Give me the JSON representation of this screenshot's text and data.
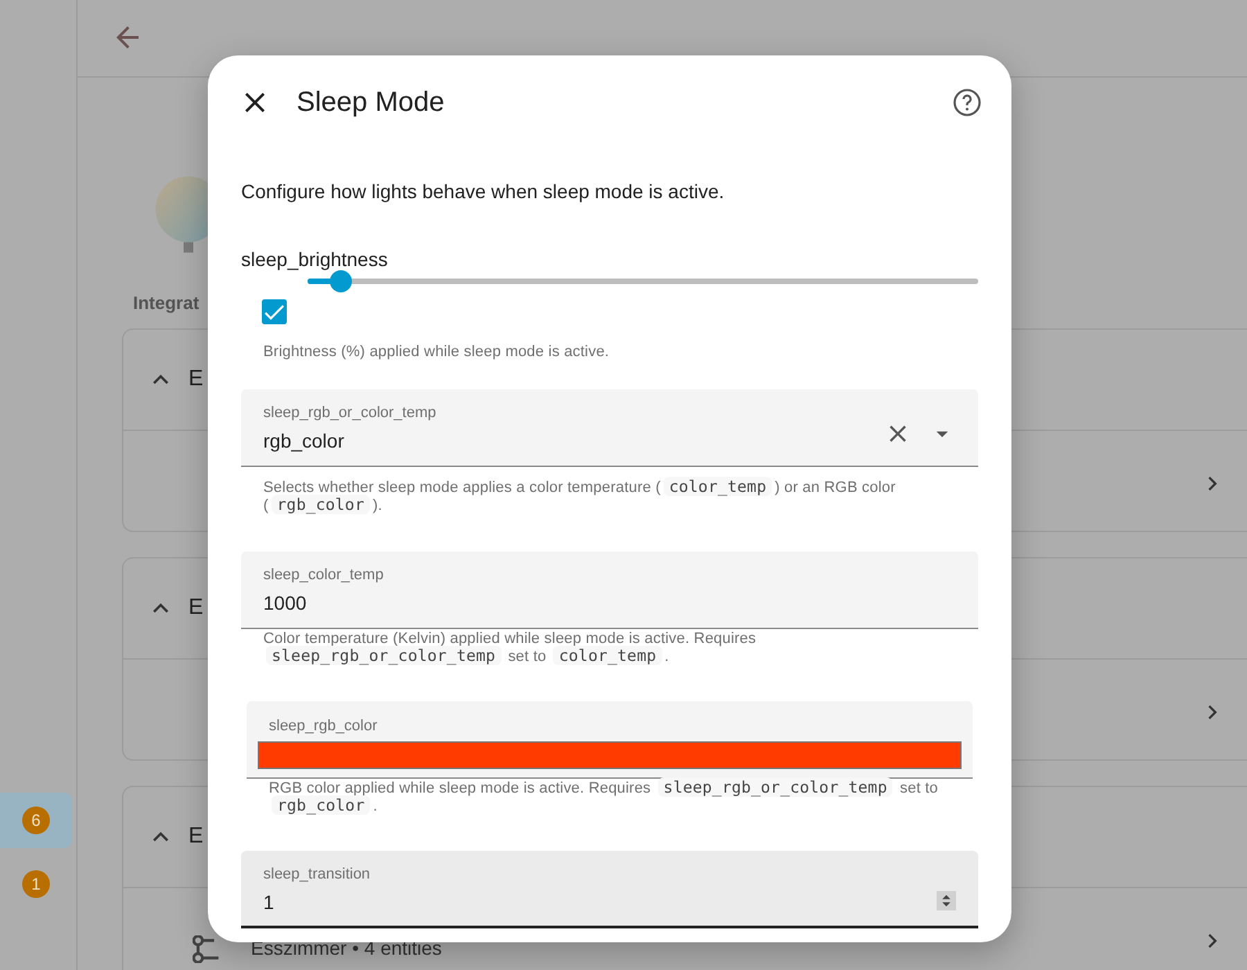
{
  "background": {
    "nav_badges": [
      {
        "text": "6",
        "selected": true
      },
      {
        "text": "1",
        "selected": false
      }
    ],
    "section_heading": "Integrat",
    "cards": [
      {
        "title": "E",
        "expanded": true
      },
      {
        "title": "E",
        "expanded": true
      },
      {
        "title": "E",
        "expanded": true,
        "subtitle": "Esszimmer • 4 entities"
      }
    ]
  },
  "dialog": {
    "title": "Sleep Mode",
    "intro": "Configure how lights behave when sleep mode is active.",
    "fields": [
      {
        "kind": "slider",
        "label": "sleep_brightness",
        "level": 0.05,
        "checked": true,
        "helper": [
          {
            "kind": "text",
            "text": "Brightness (%) applied while sleep mode is active."
          }
        ]
      },
      {
        "kind": "select",
        "label": "sleep_rgb_or_color_temp",
        "value": "rgb_color",
        "helper": [
          {
            "kind": "text",
            "text": "Selects whether sleep mode applies a color temperature ("
          },
          {
            "kind": "code",
            "text": "color_temp"
          },
          {
            "kind": "text",
            "text": ") or an RGB color ("
          },
          {
            "kind": "code",
            "text": "rgb_color"
          },
          {
            "kind": "text",
            "text": ")."
          }
        ]
      },
      {
        "kind": "text",
        "label": "sleep_color_temp",
        "value": "1000",
        "helper": [
          {
            "kind": "text",
            "text": "Color temperature (Kelvin) applied while sleep mode is active. Requires "
          },
          {
            "kind": "code",
            "text": "sleep_rgb_or_color_temp"
          },
          {
            "kind": "text",
            "text": " set to "
          },
          {
            "kind": "code",
            "text": "color_temp"
          },
          {
            "kind": "text",
            "text": "."
          }
        ]
      },
      {
        "kind": "color",
        "label": "sleep_rgb_color",
        "color": "#ff3b00",
        "helper": [
          {
            "kind": "text",
            "text": "RGB color applied while sleep mode is active. Requires "
          },
          {
            "kind": "code",
            "text": "sleep_rgb_or_color_temp"
          },
          {
            "kind": "text",
            "text": " set to "
          },
          {
            "kind": "code",
            "text": "rgb_color"
          },
          {
            "kind": "text",
            "text": "."
          }
        ]
      },
      {
        "kind": "number",
        "label": "sleep_transition",
        "value": "1"
      }
    ]
  }
}
